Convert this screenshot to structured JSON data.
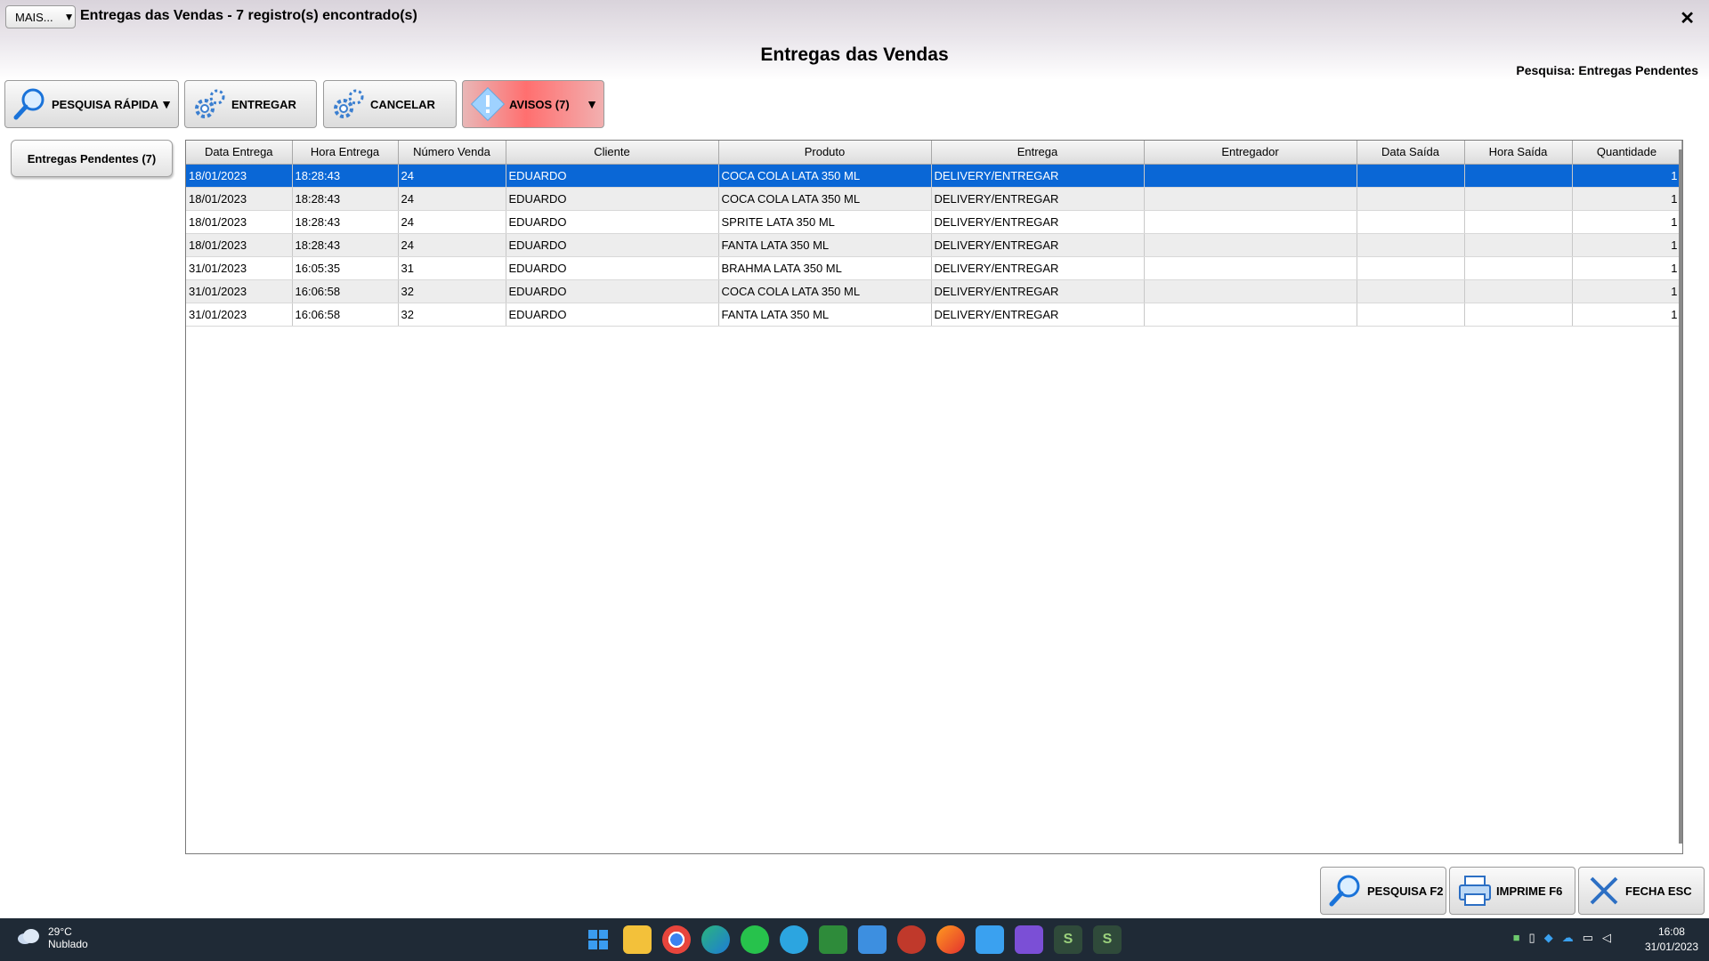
{
  "window": {
    "mais_label": "MAIS...",
    "title": "Entregas das Vendas - 7 registro(s) encontrado(s)",
    "close_glyph": "✕"
  },
  "header": {
    "title": "Entregas das Vendas",
    "search_info": "Pesquisa: Entregas Pendentes"
  },
  "toolbar": {
    "pesquisa_label": "PESQUISA RÁPIDA",
    "entregar_label": "ENTREGAR",
    "cancelar_label": "CANCELAR",
    "avisos_label": "AVISOS (7)"
  },
  "tabs": {
    "pendentes_label": "Entregas Pendentes (7)"
  },
  "grid": {
    "columns": [
      "Data Entrega",
      "Hora Entrega",
      "Número Venda",
      "Cliente",
      "Produto",
      "Entrega",
      "Entregador",
      "Data Saída",
      "Hora Saída",
      "Quantidade"
    ],
    "rows": [
      [
        "18/01/2023",
        "18:28:43",
        "24",
        "EDUARDO",
        "COCA COLA LATA 350 ML",
        "DELIVERY/ENTREGAR",
        "",
        "",
        "",
        "1"
      ],
      [
        "18/01/2023",
        "18:28:43",
        "24",
        "EDUARDO",
        "COCA COLA LATA 350 ML",
        "DELIVERY/ENTREGAR",
        "",
        "",
        "",
        "1"
      ],
      [
        "18/01/2023",
        "18:28:43",
        "24",
        "EDUARDO",
        "SPRITE LATA 350 ML",
        "DELIVERY/ENTREGAR",
        "",
        "",
        "",
        "1"
      ],
      [
        "18/01/2023",
        "18:28:43",
        "24",
        "EDUARDO",
        "FANTA LATA 350 ML",
        "DELIVERY/ENTREGAR",
        "",
        "",
        "",
        "1"
      ],
      [
        "31/01/2023",
        "16:05:35",
        "31",
        "EDUARDO",
        "BRAHMA LATA 350 ML",
        "DELIVERY/ENTREGAR",
        "",
        "",
        "",
        "1"
      ],
      [
        "31/01/2023",
        "16:06:58",
        "32",
        "EDUARDO",
        "COCA COLA LATA 350 ML",
        "DELIVERY/ENTREGAR",
        "",
        "",
        "",
        "1"
      ],
      [
        "31/01/2023",
        "16:06:58",
        "32",
        "EDUARDO",
        "FANTA LATA 350 ML",
        "DELIVERY/ENTREGAR",
        "",
        "",
        "",
        "1"
      ]
    ],
    "selected_row": 0
  },
  "bottom": {
    "pesquisa_label": "PESQUISA F2",
    "imprime_label": "IMPRIME F6",
    "fecha_label": "FECHA ESC"
  },
  "taskbar": {
    "temperature": "29°C",
    "condition": "Nublado",
    "time": "16:08",
    "date": "31/01/2023",
    "apps": [
      "start-icon",
      "file-explorer-icon",
      "chrome-icon",
      "edge-icon",
      "whatsapp-icon",
      "telegram-icon",
      "spreadsheet-icon",
      "mail-icon",
      "app-icon",
      "firefox-icon",
      "notepad-icon",
      "video-editor-icon",
      "system-app-icon",
      "system-app-2-icon"
    ]
  },
  "colors": {
    "selection": "#0a67d6",
    "avisos": "#ff6f6f",
    "taskbar": "#1f2a36"
  }
}
